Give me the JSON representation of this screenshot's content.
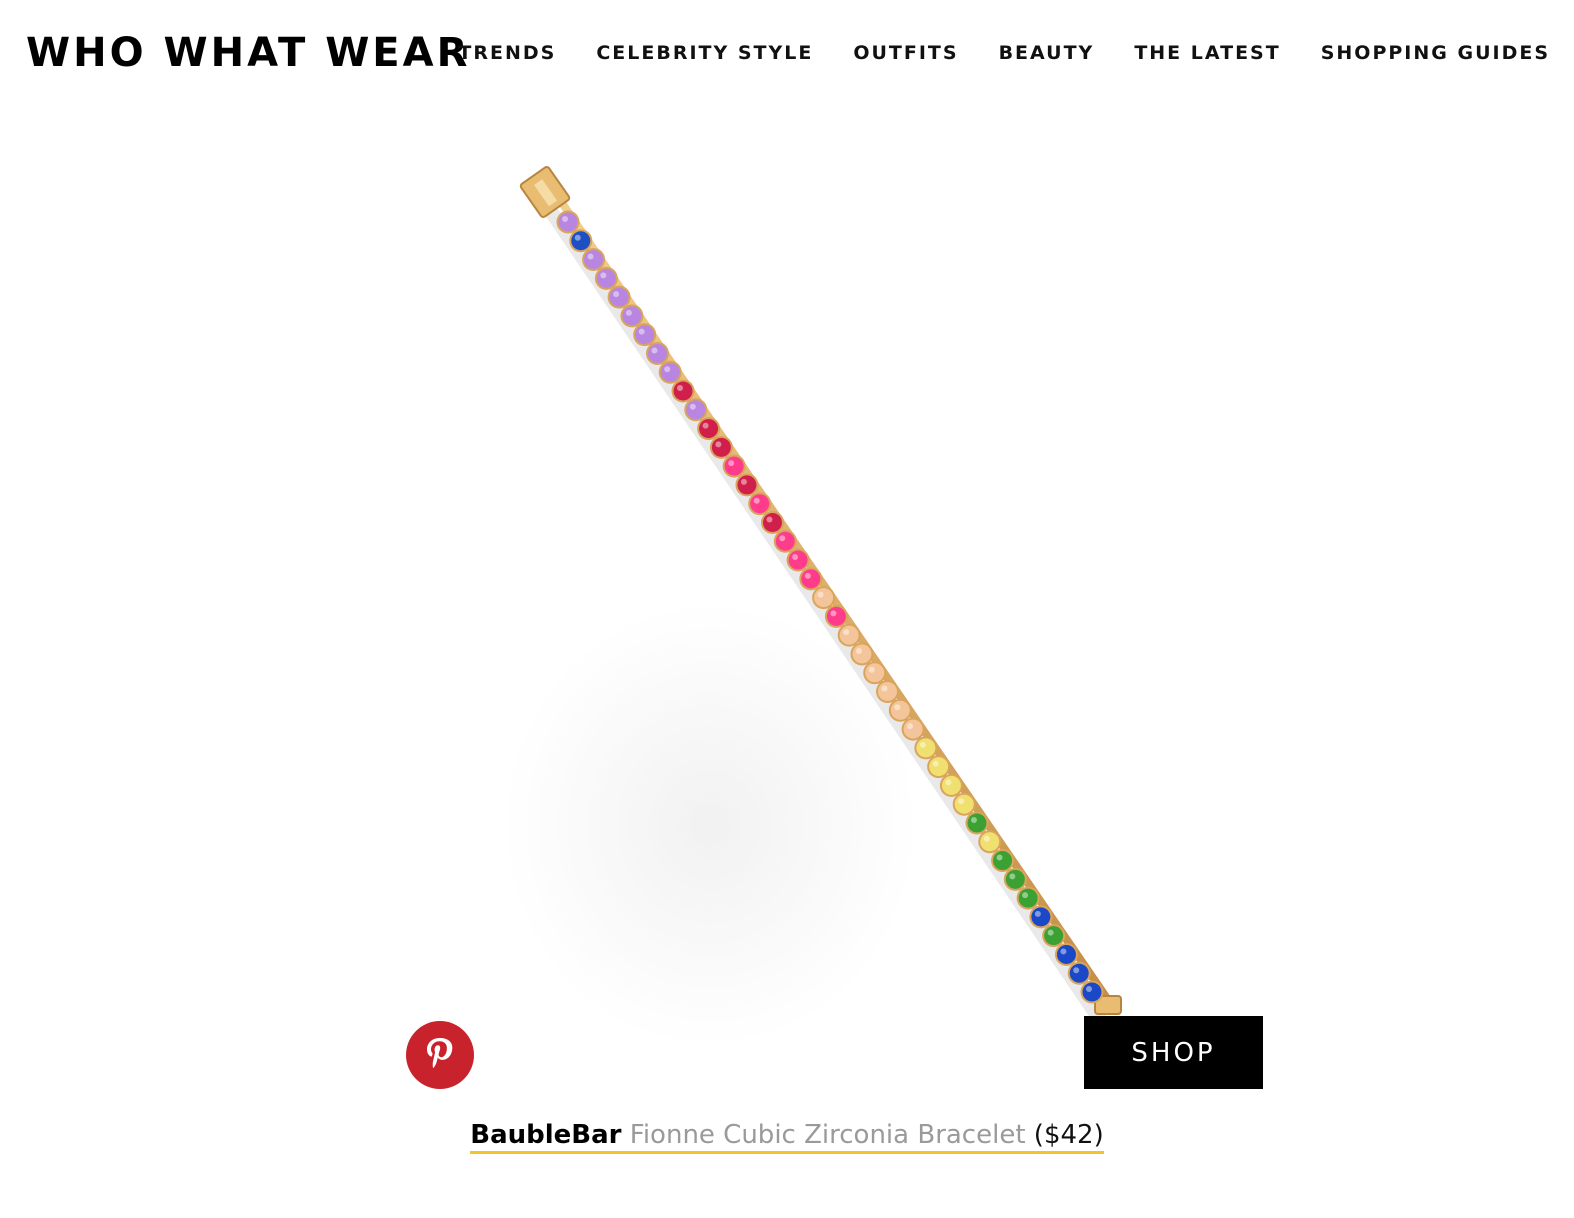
{
  "header": {
    "logo": "WHO WHAT WEAR",
    "nav": [
      "TRENDS",
      "CELEBRITY STYLE",
      "OUTFITS",
      "BEAUTY",
      "THE LATEST",
      "SHOPPING GUIDES"
    ]
  },
  "product": {
    "image_subject": "rainbow tennis bracelet",
    "shop_label": "SHOP",
    "pin_icon": "pinterest-icon",
    "brand": "BaubleBar",
    "name": "Fionne Cubic Zirconia Bracelet",
    "price": "($42)",
    "gem_colors": [
      "#b886e0",
      "#1e4fc4",
      "#c04fd0",
      "#d01f4a",
      "#ff3c8c",
      "#f4c59a",
      "#f0e070",
      "#3aa132",
      "#1b48c6"
    ]
  },
  "colors": {
    "pinterest": "#c8232c",
    "underline": "#f3c32a",
    "gold": "#d9a45b"
  }
}
